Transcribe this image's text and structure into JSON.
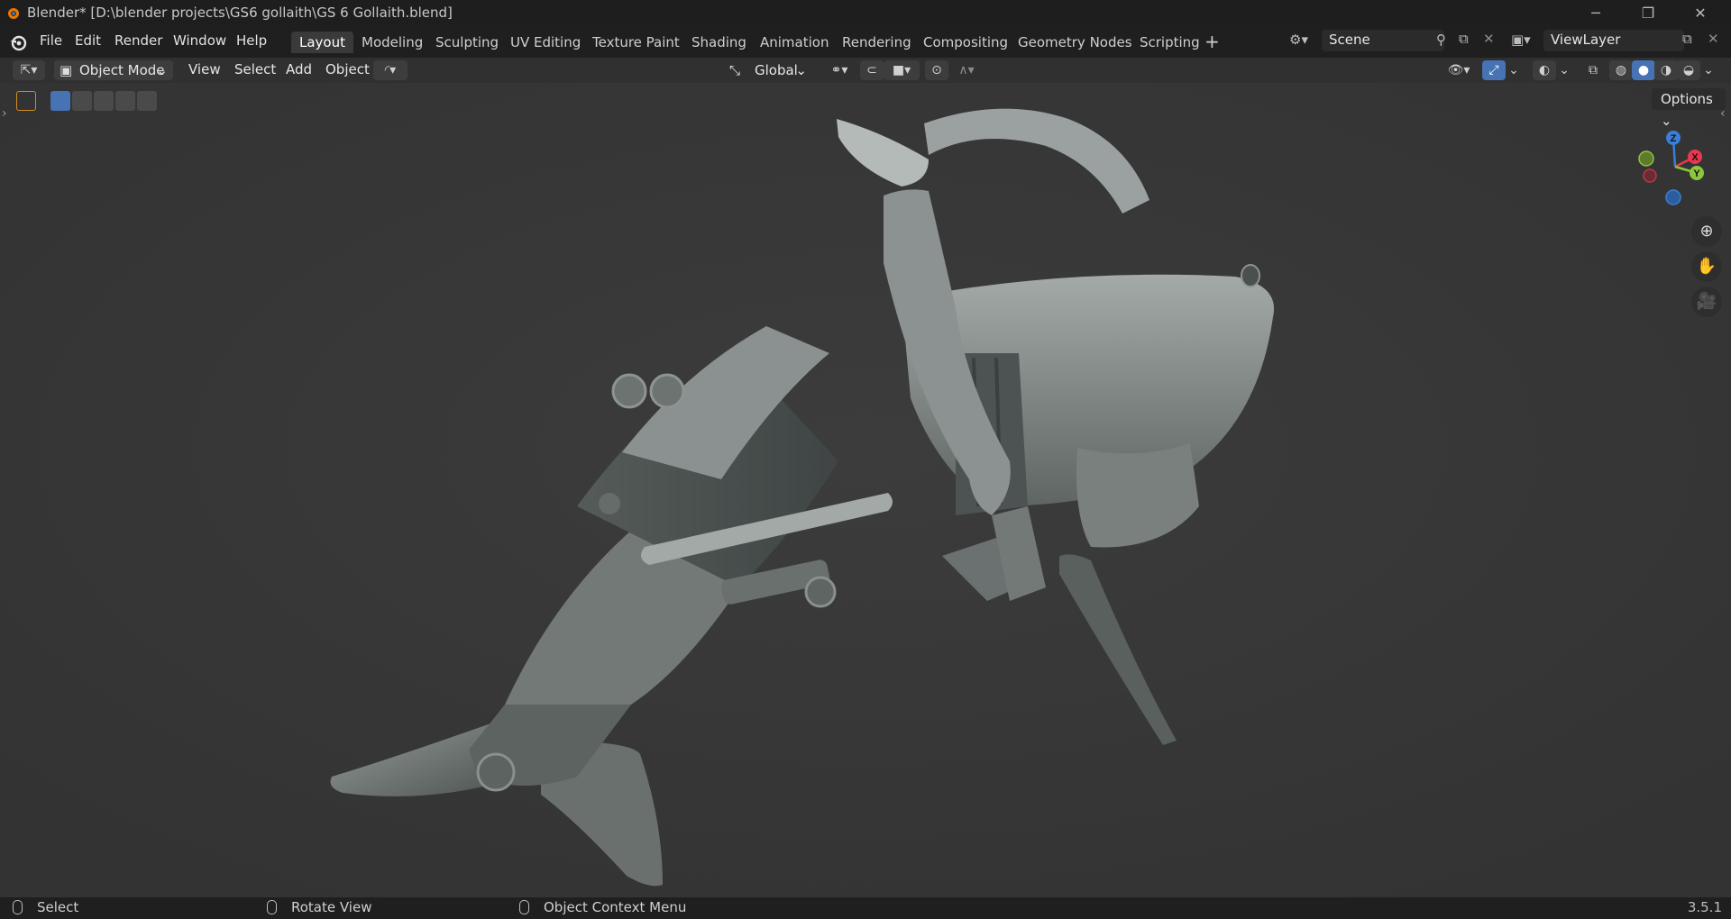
{
  "window": {
    "title": "Blender* [D:\\blender projects\\GS6 gollaith\\GS 6 Gollaith.blend]",
    "controls": {
      "minimize": "─",
      "restore": "❐",
      "close": "✕"
    }
  },
  "menubar": {
    "items": [
      "File",
      "Edit",
      "Render",
      "Window",
      "Help"
    ],
    "workspaces": [
      "Layout",
      "Modeling",
      "Sculpting",
      "UV Editing",
      "Texture Paint",
      "Shading",
      "Animation",
      "Rendering",
      "Compositing",
      "Geometry Nodes",
      "Scripting"
    ],
    "active_workspace": "Layout",
    "add_workspace": "+",
    "scene": "Scene",
    "view_layer": "ViewLayer"
  },
  "header": {
    "mode": "Object Mode",
    "menus": [
      "View",
      "Select",
      "Add",
      "Object"
    ],
    "transform_orientation": "Global"
  },
  "viewport": {
    "options_label": "Options",
    "gizmo": {
      "x": "X",
      "y": "Y",
      "z": "Z"
    },
    "colors": {
      "x": "#e8374f",
      "y": "#8bc63d",
      "z": "#3b7ed8",
      "accent": "#4772b3"
    }
  },
  "statusbar": {
    "select": "Select",
    "rotate": "Rotate View",
    "context_menu": "Object Context Menu",
    "version": "3.5.1"
  }
}
